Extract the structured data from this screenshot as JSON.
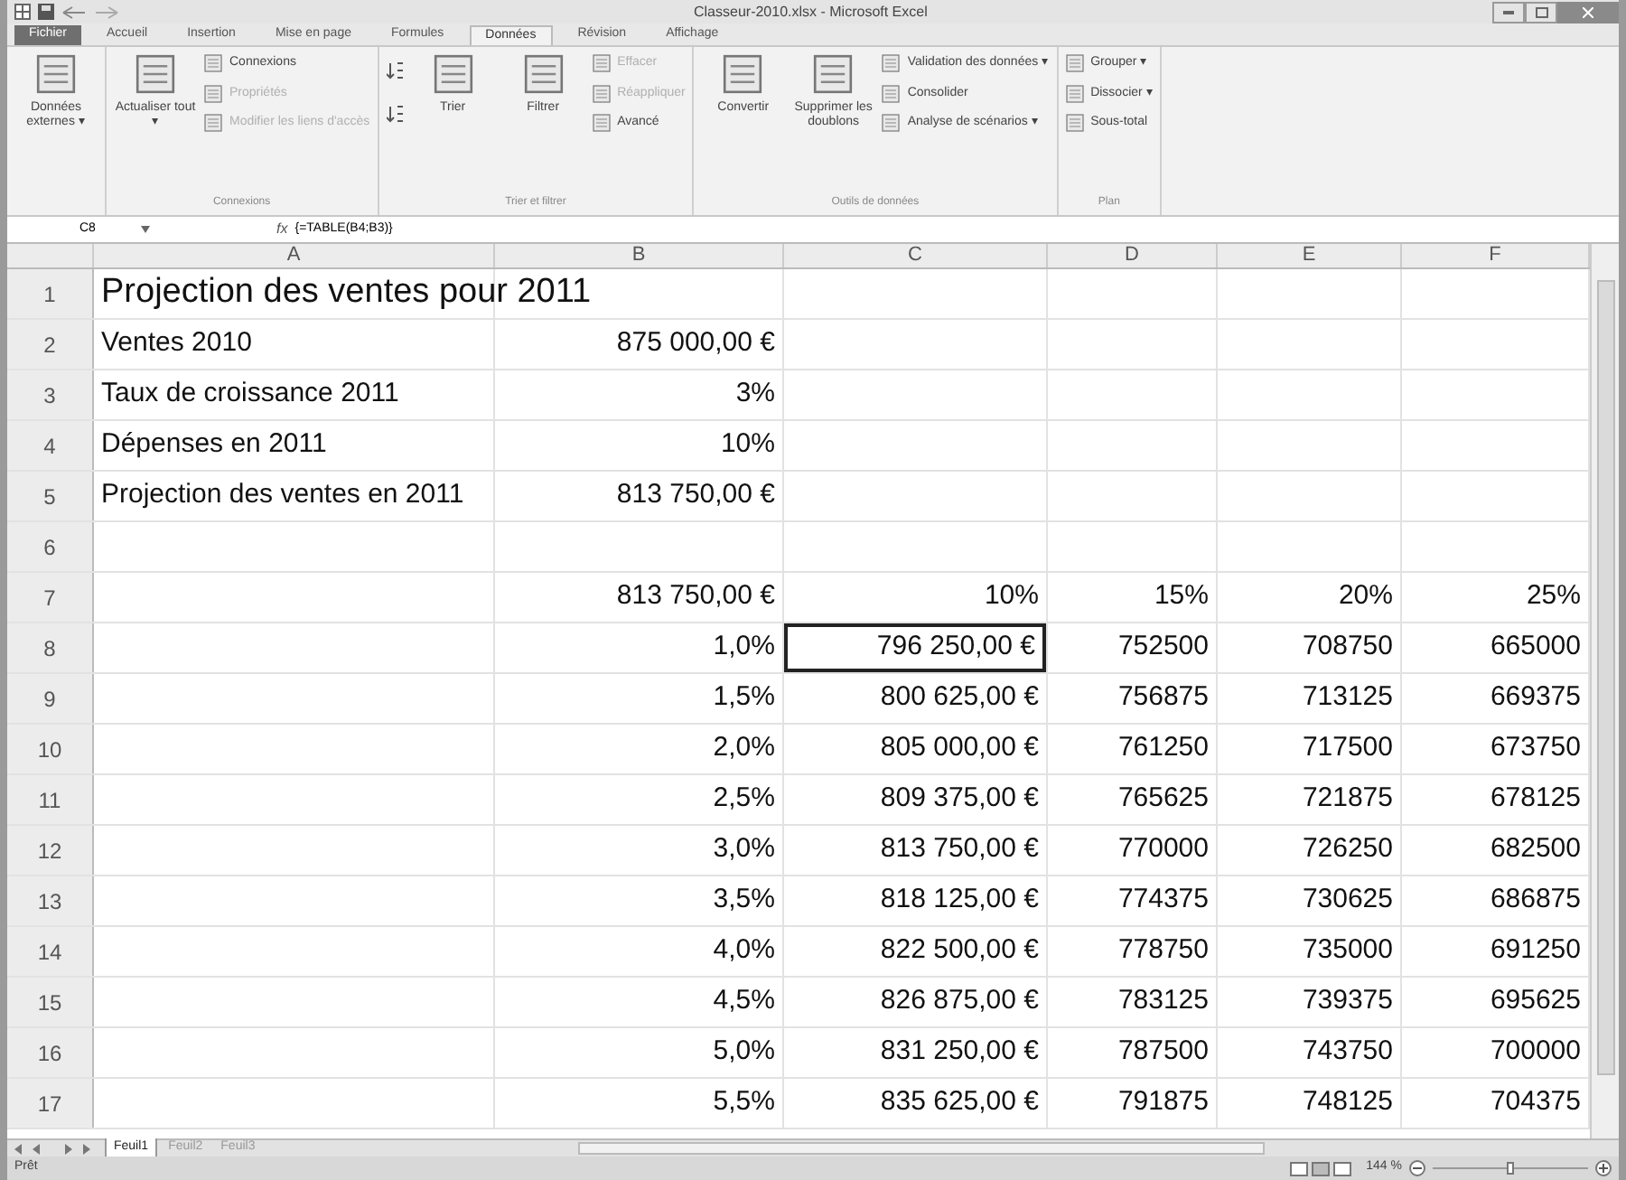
{
  "window": {
    "title": "Classeur-2010.xlsx - Microsoft Excel"
  },
  "tabs": [
    {
      "label": "Fichier",
      "selected": false,
      "kind": "file"
    },
    {
      "label": "Accueil",
      "selected": false,
      "kind": "tab"
    },
    {
      "label": "Insertion",
      "selected": false,
      "kind": "tab"
    },
    {
      "label": "Mise en page",
      "selected": false,
      "kind": "tab"
    },
    {
      "label": "Formules",
      "selected": false,
      "kind": "tab"
    },
    {
      "label": "Données",
      "selected": true,
      "kind": "tab"
    },
    {
      "label": "Révision",
      "selected": false,
      "kind": "tab"
    },
    {
      "label": "Affichage",
      "selected": false,
      "kind": "tab"
    }
  ],
  "ribbon": [
    {
      "items": [
        {
          "kind": "large",
          "label": "Données externes ▾",
          "disabled": false
        }
      ]
    },
    {
      "label": "Connexions",
      "items": [
        {
          "kind": "large",
          "label": "Actualiser tout ▾",
          "disabled": false
        },
        {
          "kind": "small",
          "label": "Connexions",
          "disabled": false
        },
        {
          "kind": "small",
          "label": "Propriétés",
          "disabled": true
        },
        {
          "kind": "small",
          "label": "Modifier les liens d'accès",
          "disabled": true
        }
      ]
    },
    {
      "label": "Trier et filtrer",
      "items": [
        {
          "kind": "icon",
          "disabled": false
        },
        {
          "kind": "large",
          "label": "Trier",
          "disabled": false
        },
        {
          "kind": "large",
          "label": "Filtrer",
          "disabled": false
        },
        {
          "kind": "small",
          "label": "Effacer",
          "disabled": true
        },
        {
          "kind": "small",
          "label": "Réappliquer",
          "disabled": true
        },
        {
          "kind": "small",
          "label": "Avancé",
          "disabled": false
        }
      ]
    },
    {
      "label": "Outils de données",
      "items": [
        {
          "kind": "large",
          "label": "Convertir",
          "disabled": false
        },
        {
          "kind": "large",
          "label": "Supprimer les doublons",
          "disabled": false
        },
        {
          "kind": "small",
          "label": "Validation des données ▾",
          "disabled": false
        },
        {
          "kind": "small",
          "label": "Consolider",
          "disabled": false
        },
        {
          "kind": "small",
          "label": "Analyse de scénarios ▾",
          "disabled": false
        }
      ]
    },
    {
      "label": "Plan",
      "items": [
        {
          "kind": "small",
          "label": "Grouper ▾",
          "disabled": false
        },
        {
          "kind": "small",
          "label": "Dissocier ▾",
          "disabled": false
        },
        {
          "kind": "small",
          "label": "Sous-total",
          "disabled": false
        }
      ]
    }
  ],
  "formula_bar": {
    "name_box": "C8",
    "function_label": "fx",
    "formula": "{=TABLE(B4;B3)}"
  },
  "columns": [
    "A",
    "B",
    "C",
    "D",
    "E",
    "F"
  ],
  "rows": [
    {
      "header": "1",
      "cells": [
        {
          "text": "Projection des ventes pour 2011",
          "kind": "title",
          "selected": false
        },
        null,
        null,
        null,
        null,
        null
      ]
    },
    {
      "header": "2",
      "cells": [
        {
          "text": "Ventes 2010",
          "selected": false
        },
        {
          "text": "875 000,00 €",
          "selected": false
        },
        null,
        null,
        null,
        null
      ]
    },
    {
      "header": "3",
      "cells": [
        {
          "text": "Taux de croissance 2011",
          "selected": false
        },
        {
          "text": "3%",
          "selected": false
        },
        null,
        null,
        null,
        null
      ]
    },
    {
      "header": "4",
      "cells": [
        {
          "text": "Dépenses en 2011",
          "selected": false
        },
        {
          "text": "10%",
          "selected": false
        },
        null,
        null,
        null,
        null
      ]
    },
    {
      "header": "5",
      "cells": [
        {
          "text": "Projection des ventes en 2011",
          "selected": false
        },
        {
          "text": "813 750,00 €",
          "selected": false
        },
        null,
        null,
        null,
        null
      ]
    },
    {
      "header": "6",
      "cells": [
        null,
        null,
        null,
        null,
        null,
        null
      ]
    },
    {
      "header": "7",
      "cells": [
        null,
        {
          "text": "813 750,00 €",
          "selected": false
        },
        {
          "text": "10%",
          "selected": false
        },
        {
          "text": "15%",
          "selected": false
        },
        {
          "text": "20%",
          "selected": false
        },
        {
          "text": "25%",
          "selected": false
        }
      ]
    },
    {
      "header": "8",
      "cells": [
        null,
        {
          "text": "1,0%",
          "selected": false
        },
        {
          "text": "796 250,00 €",
          "selected": true
        },
        {
          "text": "752500",
          "selected": false
        },
        {
          "text": "708750",
          "selected": false
        },
        {
          "text": "665000",
          "selected": false
        }
      ]
    },
    {
      "header": "9",
      "cells": [
        null,
        {
          "text": "1,5%",
          "selected": false
        },
        {
          "text": "800 625,00 €",
          "selected": false
        },
        {
          "text": "756875",
          "selected": false
        },
        {
          "text": "713125",
          "selected": false
        },
        {
          "text": "669375",
          "selected": false
        }
      ]
    },
    {
      "header": "10",
      "cells": [
        null,
        {
          "text": "2,0%",
          "selected": false
        },
        {
          "text": "805 000,00 €",
          "selected": false
        },
        {
          "text": "761250",
          "selected": false
        },
        {
          "text": "717500",
          "selected": false
        },
        {
          "text": "673750",
          "selected": false
        }
      ]
    },
    {
      "header": "11",
      "cells": [
        null,
        {
          "text": "2,5%",
          "selected": false
        },
        {
          "text": "809 375,00 €",
          "selected": false
        },
        {
          "text": "765625",
          "selected": false
        },
        {
          "text": "721875",
          "selected": false
        },
        {
          "text": "678125",
          "selected": false
        }
      ]
    },
    {
      "header": "12",
      "cells": [
        null,
        {
          "text": "3,0%",
          "selected": false
        },
        {
          "text": "813 750,00 €",
          "selected": false
        },
        {
          "text": "770000",
          "selected": false
        },
        {
          "text": "726250",
          "selected": false
        },
        {
          "text": "682500",
          "selected": false
        }
      ]
    },
    {
      "header": "13",
      "cells": [
        null,
        {
          "text": "3,5%",
          "selected": false
        },
        {
          "text": "818 125,00 €",
          "selected": false
        },
        {
          "text": "774375",
          "selected": false
        },
        {
          "text": "730625",
          "selected": false
        },
        {
          "text": "686875",
          "selected": false
        }
      ]
    },
    {
      "header": "14",
      "cells": [
        null,
        {
          "text": "4,0%",
          "selected": false
        },
        {
          "text": "822 500,00 €",
          "selected": false
        },
        {
          "text": "778750",
          "selected": false
        },
        {
          "text": "735000",
          "selected": false
        },
        {
          "text": "691250",
          "selected": false
        }
      ]
    },
    {
      "header": "15",
      "cells": [
        null,
        {
          "text": "4,5%",
          "selected": false
        },
        {
          "text": "826 875,00 €",
          "selected": false
        },
        {
          "text": "783125",
          "selected": false
        },
        {
          "text": "739375",
          "selected": false
        },
        {
          "text": "695625",
          "selected": false
        }
      ]
    },
    {
      "header": "16",
      "cells": [
        null,
        {
          "text": "5,0%",
          "selected": false
        },
        {
          "text": "831 250,00 €",
          "selected": false
        },
        {
          "text": "787500",
          "selected": false
        },
        {
          "text": "743750",
          "selected": false
        },
        {
          "text": "700000",
          "selected": false
        }
      ]
    },
    {
      "header": "17",
      "cells": [
        null,
        {
          "text": "5,5%",
          "selected": false
        },
        {
          "text": "835 625,00 €",
          "selected": false
        },
        {
          "text": "791875",
          "selected": false
        },
        {
          "text": "748125",
          "selected": false
        },
        {
          "text": "704375",
          "selected": false
        }
      ]
    }
  ],
  "sheet_tabs": [
    {
      "label": "Feuil1",
      "selected": true
    },
    {
      "label": "Feuil2",
      "selected": false
    },
    {
      "label": "Feuil3",
      "selected": false
    }
  ],
  "status_bar": {
    "status": "Prêt",
    "zoom": "144 %",
    "zoom_slider": {
      "level": 0.5
    }
  }
}
